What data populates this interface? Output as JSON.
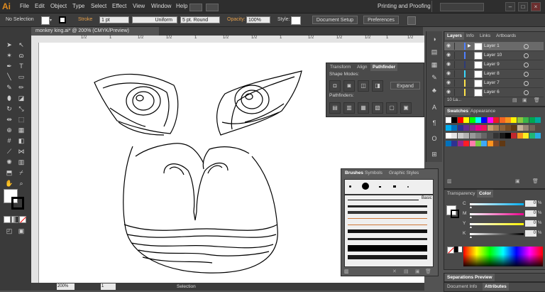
{
  "app": {
    "logo": "Ai",
    "menus": [
      "File",
      "Edit",
      "Object",
      "Type",
      "Select",
      "Effect",
      "View",
      "Window",
      "Help"
    ],
    "workspace": "Printing and Proofing"
  },
  "control": {
    "selection": "No Selection",
    "stroke_label": "Stroke",
    "stroke_value": "1 pt",
    "profile": "Uniform",
    "brush": "5 pt. Round",
    "opacity_label": "Opacity:",
    "opacity_value": "100%",
    "style_label": "Style:",
    "doc_setup": "Document Setup",
    "preferences": "Preferences"
  },
  "document": {
    "tab_title": "monkey king.ai* @ 200% (CMYK/Preview)",
    "ruler_ticks": [
      "1/2",
      "1",
      "1/2",
      "1/2",
      "1",
      "1/2",
      "1/2",
      "1",
      "1/2",
      "1/2",
      "1/2",
      "1",
      "1/2"
    ]
  },
  "status": {
    "zoom": "200%",
    "page": "1",
    "mode": "Selection"
  },
  "pathfinder": {
    "tabs": [
      "Transform",
      "Align",
      "Pathfinder"
    ],
    "shape_modes": "Shape Modes:",
    "expand": "Expand",
    "pathfinders": "Pathfinders:"
  },
  "brushes": {
    "tabs": [
      "Brushes",
      "Symbols",
      "Graphic Styles"
    ],
    "basic": "Basic"
  },
  "layers": {
    "tabs": [
      "Layers",
      "Info",
      "Links",
      "Artboards"
    ],
    "rows": [
      {
        "name": "Layer 1",
        "color": "#4f7fff",
        "selected": true
      },
      {
        "name": "Layer 10",
        "color": "#4f7fff",
        "selected": false
      },
      {
        "name": "Layer 9",
        "color": "#2e3b78",
        "selected": false
      },
      {
        "name": "Layer 8",
        "color": "#3ad8ff",
        "selected": false
      },
      {
        "name": "Layer 7",
        "color": "#ffe24a",
        "selected": false
      },
      {
        "name": "Layer 6",
        "color": "#ffe24a",
        "selected": false
      }
    ],
    "count": "10 La..."
  },
  "swatches": {
    "tabs": [
      "Swatches",
      "Appearance"
    ],
    "colors": [
      "#ffffff",
      "#000000",
      "#ff0000",
      "#ffff00",
      "#00ff00",
      "#00ffff",
      "#0000ff",
      "#ff00ff",
      "#ed1c24",
      "#f26522",
      "#f7941d",
      "#fff200",
      "#8dc63f",
      "#39b54a",
      "#00a651",
      "#00a99d",
      "#00aeef",
      "#0072bc",
      "#2e3192",
      "#662d91",
      "#92278f",
      "#ec008c",
      "#ed145b",
      "#c69c6d",
      "#a67c52",
      "#8c6239",
      "#754c24",
      "#603913",
      "#c7b299",
      "#998675",
      "#736357",
      "#534741",
      "#ffffff",
      "#e6e6e6",
      "#cccccc",
      "#b3b3b3",
      "#999999",
      "#808080",
      "#666666",
      "#4d4d4d",
      "#333333",
      "#1a1a1a",
      "#000000",
      "#c1272d",
      "#f7931e",
      "#fcee21",
      "#22b573",
      "#29abe2",
      "#0071bc",
      "#2e3192",
      "#93278f",
      "#ff1d25",
      "#ff7bac",
      "#7ac943",
      "#3fa9f5",
      "#ff931e",
      "#7f4726",
      "#603813"
    ]
  },
  "color_panel": {
    "tabs": [
      "Transparency",
      "Color"
    ],
    "channels": [
      {
        "label": "C",
        "value": "0",
        "color": "#00aeef"
      },
      {
        "label": "M",
        "value": "0",
        "color": "#ec008c"
      },
      {
        "label": "Y",
        "value": "0",
        "color": "#fff200"
      },
      {
        "label": "K",
        "value": "0",
        "color": "#000000"
      }
    ],
    "pct": "%"
  },
  "separations": {
    "title": "Separations Preview"
  },
  "bottom_tabs": [
    "Document Info",
    "Attributes"
  ],
  "accent": "#e7a04a"
}
